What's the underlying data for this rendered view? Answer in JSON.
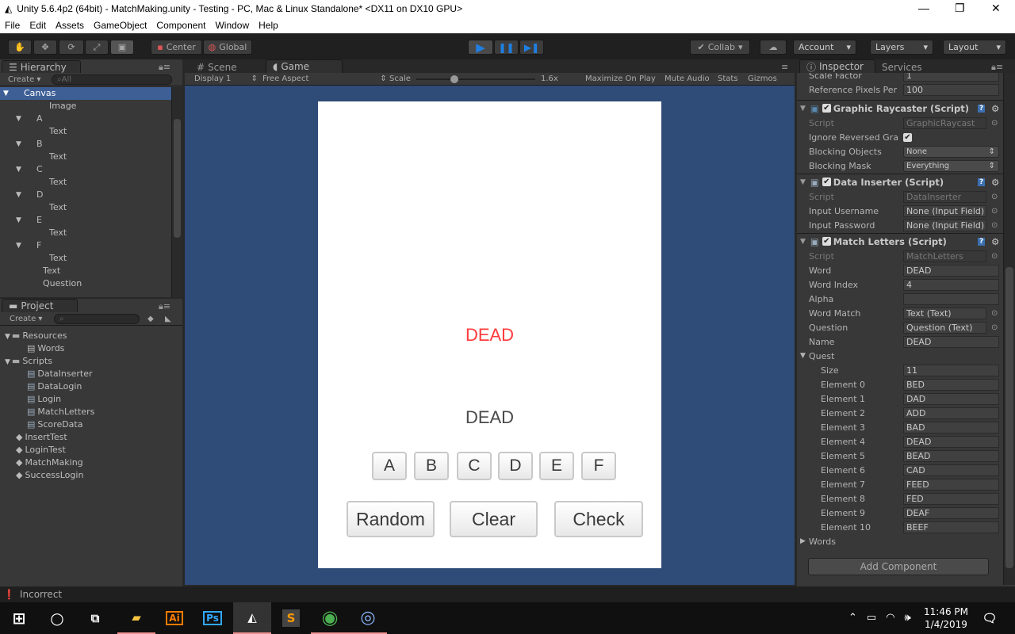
{
  "window": {
    "title": "Unity 5.6.4p2 (64bit) - MatchMaking.unity - Testing - PC, Mac & Linux Standalone* <DX11 on DX10 GPU>"
  },
  "menu": [
    "File",
    "Edit",
    "Assets",
    "GameObject",
    "Component",
    "Window",
    "Help"
  ],
  "toolbar": {
    "center": "Center",
    "global": "Global",
    "collab": "Collab",
    "account": "Account",
    "layers": "Layers",
    "layout": "Layout"
  },
  "hierarchy": {
    "tab": "Hierarchy",
    "create": "Create",
    "search_placeholder": "All",
    "items": [
      {
        "label": "Canvas",
        "depth": 0,
        "expanded": true,
        "selected": true
      },
      {
        "label": "Image",
        "depth": 2
      },
      {
        "label": "A",
        "depth": 1,
        "expanded": true
      },
      {
        "label": "Text",
        "depth": 2
      },
      {
        "label": "B",
        "depth": 1,
        "expanded": true
      },
      {
        "label": "Text",
        "depth": 2
      },
      {
        "label": "C",
        "depth": 1,
        "expanded": true
      },
      {
        "label": "Text",
        "depth": 2
      },
      {
        "label": "D",
        "depth": 1,
        "expanded": true
      },
      {
        "label": "Text",
        "depth": 2
      },
      {
        "label": "E",
        "depth": 1,
        "expanded": true
      },
      {
        "label": "Text",
        "depth": 2
      },
      {
        "label": "F",
        "depth": 1,
        "expanded": true
      },
      {
        "label": "Text",
        "depth": 2
      },
      {
        "label": "Text",
        "depth": 1.5
      },
      {
        "label": "Question",
        "depth": 1.5
      }
    ]
  },
  "project": {
    "tab": "Project",
    "create": "Create",
    "items": [
      {
        "label": "Resources",
        "depth": 0,
        "type": "folder",
        "expanded": true
      },
      {
        "label": "Words",
        "depth": 1,
        "type": "file"
      },
      {
        "label": "Scripts",
        "depth": 0,
        "type": "folder",
        "expanded": true
      },
      {
        "label": "DataInserter",
        "depth": 1,
        "type": "script"
      },
      {
        "label": "DataLogin",
        "depth": 1,
        "type": "script"
      },
      {
        "label": "Login",
        "depth": 1,
        "type": "script"
      },
      {
        "label": "MatchLetters",
        "depth": 1,
        "type": "script"
      },
      {
        "label": "ScoreData",
        "depth": 1,
        "type": "script"
      },
      {
        "label": "InsertTest",
        "depth": 0,
        "type": "scene"
      },
      {
        "label": "LoginTest",
        "depth": 0,
        "type": "scene"
      },
      {
        "label": "MatchMaking",
        "depth": 0,
        "type": "scene"
      },
      {
        "label": "SuccessLogin",
        "depth": 0,
        "type": "scene"
      }
    ]
  },
  "game_view": {
    "tabs": {
      "scene": "Scene",
      "game": "Game"
    },
    "display": "Display 1",
    "aspect": "Free Aspect",
    "scale_label": "Scale",
    "scale_value": "1.6x",
    "maximize": "Maximize On Play",
    "mute": "Mute Audio",
    "stats": "Stats",
    "gizmos": "Gizmos",
    "word_match": "DEAD",
    "question": "DEAD",
    "letters": [
      "A",
      "B",
      "C",
      "D",
      "E",
      "F"
    ],
    "buttons": [
      "Random",
      "Clear",
      "Check"
    ],
    "colors": {
      "word_match": "#ff3b3b",
      "question": "#4a4a4a",
      "background": "#2f4b77"
    }
  },
  "inspector": {
    "tab": "Inspector",
    "services": "Services",
    "top_rows": [
      {
        "label": "Scale Factor",
        "value": "1"
      },
      {
        "label": "Reference Pixels Per",
        "value": "100"
      }
    ],
    "graphic_raycaster": {
      "title": "Graphic Raycaster (Script)",
      "script_label": "Script",
      "script": "GraphicRaycast",
      "ignore_label": "Ignore Reversed Gra",
      "blocking_objects_label": "Blocking Objects",
      "blocking_objects": "None",
      "blocking_mask_label": "Blocking Mask",
      "blocking_mask": "Everything"
    },
    "data_inserter": {
      "title": "Data Inserter (Script)",
      "script_label": "Script",
      "script": "DataInserter",
      "username_label": "Input Username",
      "username": "None (Input Field)",
      "password_label": "Input Password",
      "password": "None (Input Field)"
    },
    "match_letters": {
      "title": "Match Letters (Script)",
      "script_label": "Script",
      "script": "MatchLetters",
      "fields": [
        {
          "label": "Word",
          "value": "DEAD"
        },
        {
          "label": "Word Index",
          "value": "4"
        },
        {
          "label": "Alpha",
          "value": ""
        },
        {
          "label": "Word Match",
          "value": "Text (Text)",
          "obj": true
        },
        {
          "label": "Question",
          "value": "Question (Text)",
          "obj": true
        },
        {
          "label": "Name",
          "value": "DEAD"
        }
      ],
      "quest_label": "Quest",
      "size_label": "Size",
      "size": "11",
      "quest": [
        "BED",
        "DAD",
        "ADD",
        "BAD",
        "DEAD",
        "BEAD",
        "CAD",
        "FEED",
        "FED",
        "DEAF",
        "BEEF"
      ],
      "words_label": "Words"
    },
    "add_component": "Add Component"
  },
  "status": {
    "message": "Incorrect"
  },
  "taskbar": {
    "time": "11:46 PM",
    "date": "1/4/2019",
    "apps": [
      "file-explorer",
      "illustrator",
      "photoshop",
      "unity",
      "sublime-text",
      "chrome",
      "app"
    ]
  }
}
